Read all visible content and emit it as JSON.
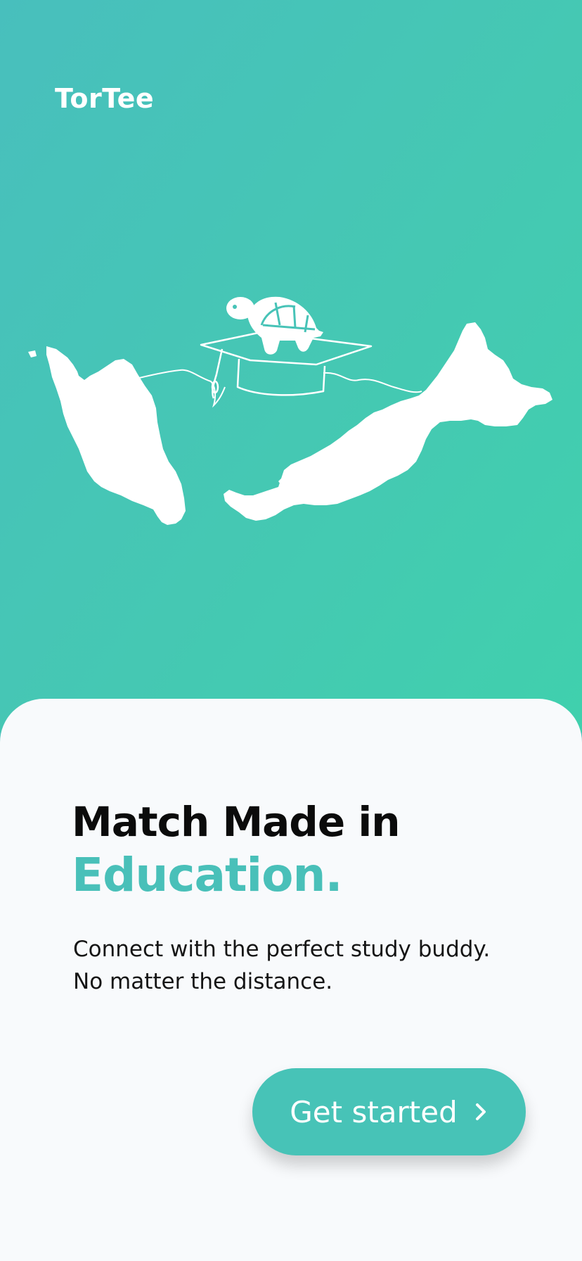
{
  "app": {
    "brand": "TorTee"
  },
  "onboarding": {
    "headline_line1": "Match Made in",
    "headline_line2": "Education.",
    "subtitle_line1": "Connect with the perfect study buddy.",
    "subtitle_line2": "No matter the distance.",
    "cta_label": "Get started",
    "cta_icon": "chevron-right-icon",
    "illustration": "malaysia-map-with-turtle-graduation-cap"
  },
  "colors": {
    "accent": "#49c0b9",
    "hero_gradient_start": "#48bfbd",
    "hero_gradient_end": "#40d0ad",
    "card_background": "#f8fafc",
    "headline_text": "#0b0b0b"
  }
}
